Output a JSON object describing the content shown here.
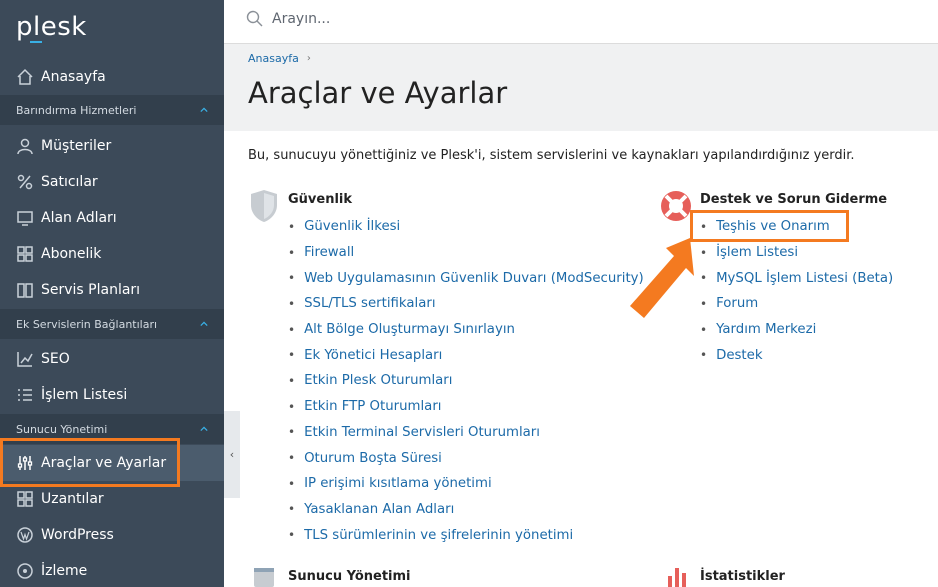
{
  "sidebar": {
    "logo": "plesk",
    "home": "Anasayfa",
    "sections": [
      {
        "title": "Barındırma Hizmetleri",
        "items": [
          "Müşteriler",
          "Satıcılar",
          "Alan Adları",
          "Abonelik",
          "Servis Planları"
        ]
      },
      {
        "title": "Ek Servislerin Bağlantıları",
        "items": [
          "SEO",
          "İşlem Listesi"
        ]
      },
      {
        "title": "Sunucu Yönetimi",
        "items": [
          "Araçlar ve Ayarlar",
          "Uzantılar",
          "WordPress",
          "İzleme"
        ]
      }
    ],
    "collapse_glyph": "‹"
  },
  "search": {
    "placeholder": "Arayın..."
  },
  "breadcrumb": {
    "home": "Anasayfa",
    "sep": "›"
  },
  "page": {
    "title": "Araçlar ve Ayarlar",
    "intro": "Bu, sunucuyu yönettiğiniz ve Plesk'i, sistem servislerini ve kaynakları yapılandırdığınız yerdir."
  },
  "security": {
    "title": "Güvenlik",
    "links": [
      "Güvenlik İlkesi",
      "Firewall",
      "Web Uygulamasının Güvenlik Duvarı (ModSecurity)",
      "SSL/TLS sertifikaları",
      "Alt Bölge Oluşturmayı Sınırlayın",
      "Ek Yönetici Hesapları",
      "Etkin Plesk Oturumları",
      "Etkin FTP Oturumları",
      "Etkin Terminal Servisleri Oturumları",
      "Oturum Boşta Süresi",
      "IP erişimi kısıtlama yönetimi",
      "Yasaklanan Alan Adları",
      "TLS sürümlerinin ve şifrelerinin yönetimi"
    ]
  },
  "support": {
    "title": "Destek ve Sorun Giderme",
    "links": [
      "Teşhis ve Onarım",
      "İşlem Listesi",
      "MySQL İşlem Listesi (Beta)",
      "Forum",
      "Yardım Merkezi",
      "Destek"
    ]
  },
  "server_management": {
    "title": "Sunucu Yönetimi"
  },
  "statistics": {
    "title": "İstatistikler"
  },
  "colors": {
    "sidebar": "#3c4a59",
    "link": "#1c6aa8",
    "highlight": "#f47a20"
  }
}
